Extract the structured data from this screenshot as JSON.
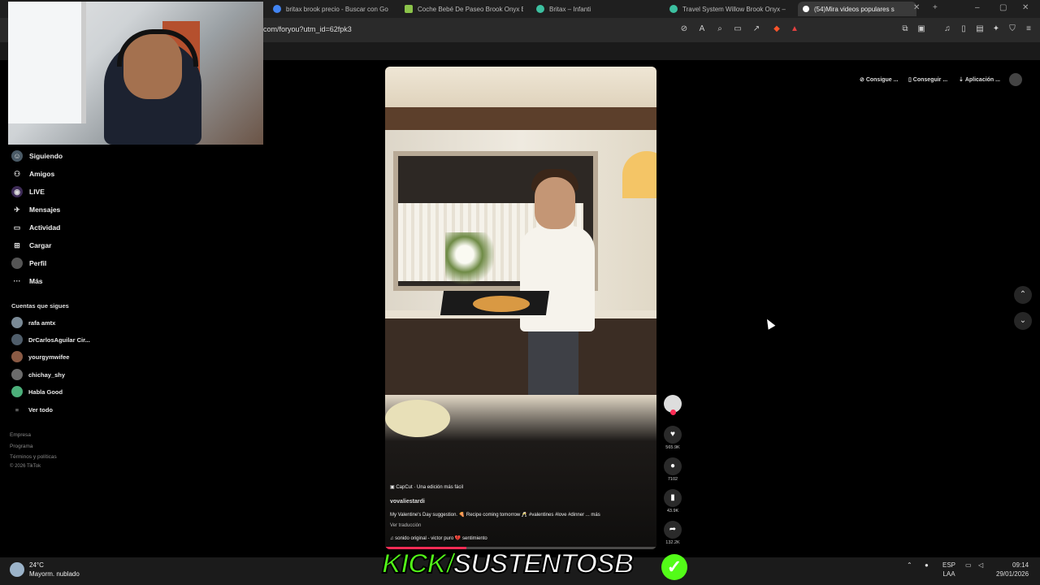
{
  "tabs": [
    {
      "label": "britax brook precio - Buscar con Go",
      "favicon_color": "#4285f4"
    },
    {
      "label": "Coche Bebé De Paseo Brook Onyx B",
      "favicon_color": "#8bc34a"
    },
    {
      "label": "Britax – Infanti",
      "favicon_color": "#3cc0a0"
    },
    {
      "label": "Travel System Willow Brook Onyx –",
      "favicon_color": "#3cc0a0"
    },
    {
      "label": "(54)Mira videos populares s",
      "favicon_color": "#ffffff"
    }
  ],
  "address": {
    "url": "com/foryou?utm_id=62fpk3"
  },
  "sidebar": {
    "nav": [
      {
        "label": "Siguiendo",
        "icon": "following-icon"
      },
      {
        "label": "Amigos",
        "icon": "friends-icon"
      },
      {
        "label": "LIVE",
        "icon": "live-icon"
      },
      {
        "label": "Mensajes",
        "icon": "messages-icon"
      },
      {
        "label": "Actividad",
        "icon": "activity-icon"
      },
      {
        "label": "Cargar",
        "icon": "upload-icon"
      },
      {
        "label": "Perfil",
        "icon": "profile-icon"
      },
      {
        "label": "Más",
        "icon": "more-icon"
      }
    ],
    "following_title": "Cuentas que sigues",
    "accounts": [
      "rafa amtx",
      "DrCarlosAguilar Cir...",
      "yourgymwifee",
      "chichay_shy",
      "Habla Good"
    ],
    "see_all": "Ver todo",
    "footer": [
      "Empresa",
      "Programa",
      "Términos y políticas",
      "© 2026 TikTok"
    ]
  },
  "top_actions": [
    "Consigue ...",
    "Conseguir ...",
    "Aplicación ..."
  ],
  "video": {
    "capcut": "CapCut · Una edición más fácil",
    "author": "vovaliestardi",
    "caption": "My Valentine's Day suggestion. 🍕 Recipe coming tomorrow 🥂 #valentines #love #dinner ... más",
    "translate": "Ver traducción",
    "music": "♫  sonido original - victor puro 💔 sentimiento",
    "progress": 0.3
  },
  "actions": {
    "likes": "565.9K",
    "comments": "7102",
    "saves": "43.9K",
    "shares": "132.2K"
  },
  "taskbar": {
    "temp": "24°C",
    "weather": "Mayorm. nublado",
    "lang1": "ESP",
    "lang2": "LAA",
    "time": "09:14",
    "date": "29/01/2026"
  },
  "overlay": {
    "kick_prefix": "KICK/",
    "kick_name": "SUSTENTOSB"
  }
}
